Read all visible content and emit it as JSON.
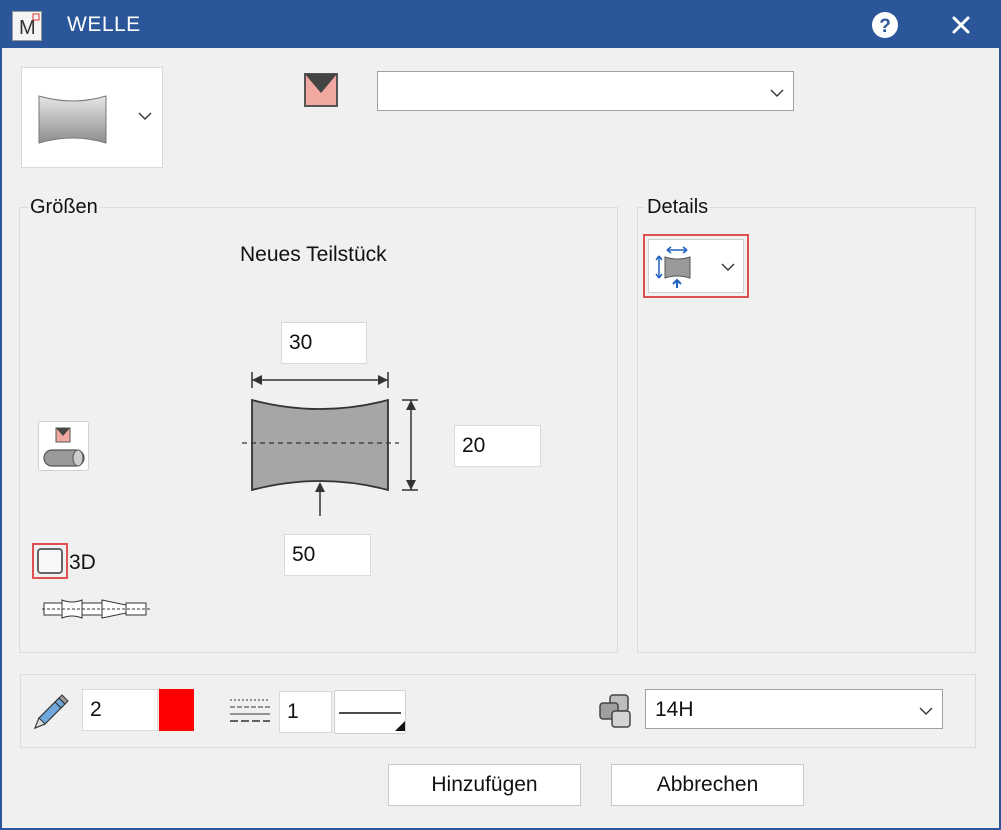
{
  "window": {
    "title": "WELLE",
    "app_icon_letter": "M"
  },
  "profile_select": {
    "value": ""
  },
  "groups": {
    "sizes_label": "Größen",
    "details_label": "Details"
  },
  "sizes": {
    "heading": "Neues Teilstück",
    "width": "30",
    "height": "20",
    "depth": "50",
    "threed_label": "3D",
    "threed_checked": false
  },
  "bottom": {
    "pen_value": "2",
    "pen_color": "#ff0000",
    "line_value": "1",
    "layer_value": "14H"
  },
  "buttons": {
    "add": "Hinzufügen",
    "cancel": "Abbrechen"
  },
  "icons": {
    "title_help": "help-icon",
    "title_close": "close-icon"
  }
}
